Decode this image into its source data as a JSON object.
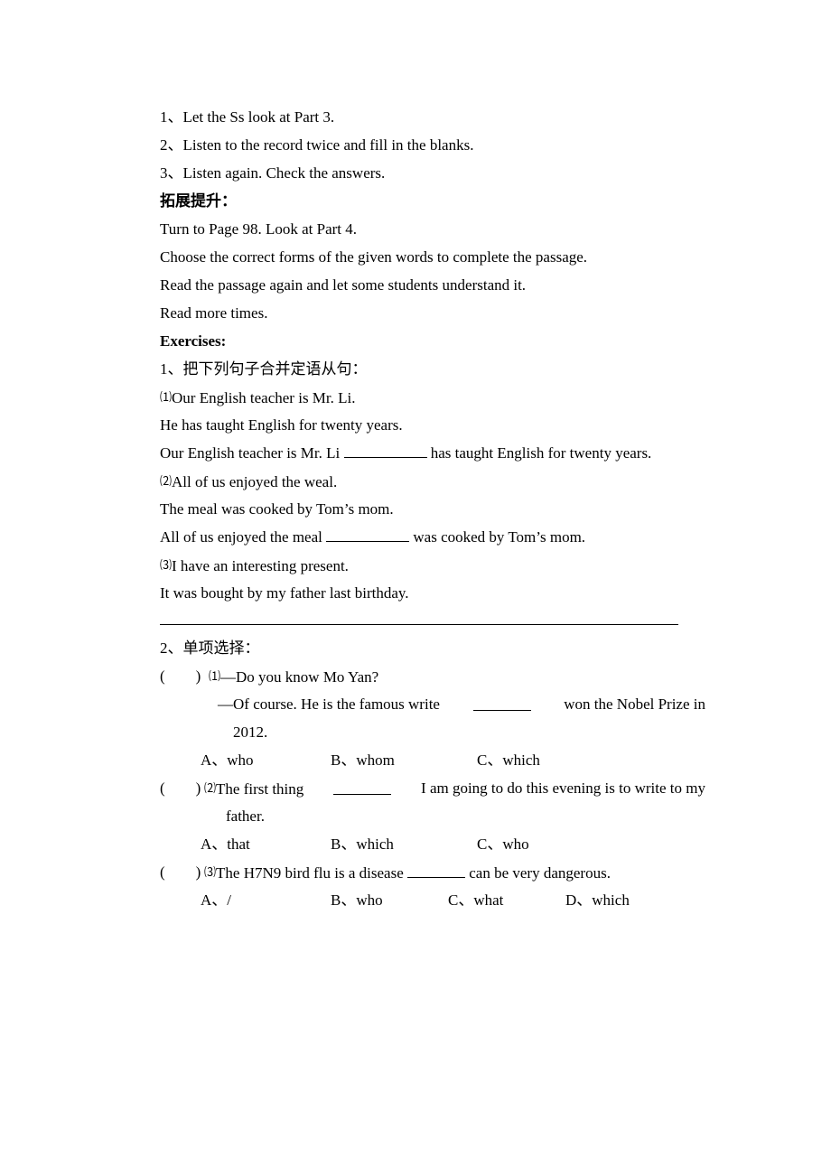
{
  "steps": [
    "1、Let the Ss look at Part 3.",
    "2、Listen to the record twice and fill in the blanks.",
    "3、Listen again. Check the answers."
  ],
  "extension": {
    "heading": "拓展提升：",
    "lines": [
      "Turn to Page 98. Look at Part 4.",
      "Choose the correct forms of the given words to complete the passage.",
      "Read the passage again and let some students understand it.",
      "Read more times."
    ]
  },
  "exercises": {
    "heading": "Exercises:",
    "part1": {
      "title": "1、把下列句子合并定语从句：",
      "items": [
        {
          "num": "⑴",
          "s1": "Our English teacher is Mr. Li.",
          "s2": "He has taught English for twenty years.",
          "combined_before": "Our English teacher is Mr. Li",
          "combined_after": "has taught English for twenty years."
        },
        {
          "num": "⑵",
          "s1": "All of us enjoyed the weal.",
          "s2": "The meal was cooked by Tom’s mom.",
          "combined_before": "All of us enjoyed the meal",
          "combined_after": "was cooked by Tom’s mom."
        },
        {
          "num": "⑶",
          "s1": "I have an interesting present.",
          "s2": "It was bought by my father last birthday."
        }
      ]
    },
    "part2": {
      "title": "2、单项选择：",
      "questions": [
        {
          "num": "⑴",
          "text1": "—Do you know Mo Yan?",
          "text2_before": "—Of course. He is the famous write",
          "text2_after": "won the Nobel Prize in",
          "text3": "2012.",
          "options": [
            "A、who",
            "B、whom",
            "C、which"
          ]
        },
        {
          "num": "⑵",
          "text1_before": "The first thing",
          "text1_after": "I am going to do this evening is to write to my",
          "text2": "father.",
          "options": [
            "A、that",
            "B、which",
            "C、who"
          ]
        },
        {
          "num": "⑶",
          "text1_before": "The H7N9 bird flu is a disease",
          "text1_after": "can be very dangerous.",
          "options": [
            "A、/",
            "B、who",
            "C、what",
            "D、which"
          ]
        }
      ]
    }
  }
}
